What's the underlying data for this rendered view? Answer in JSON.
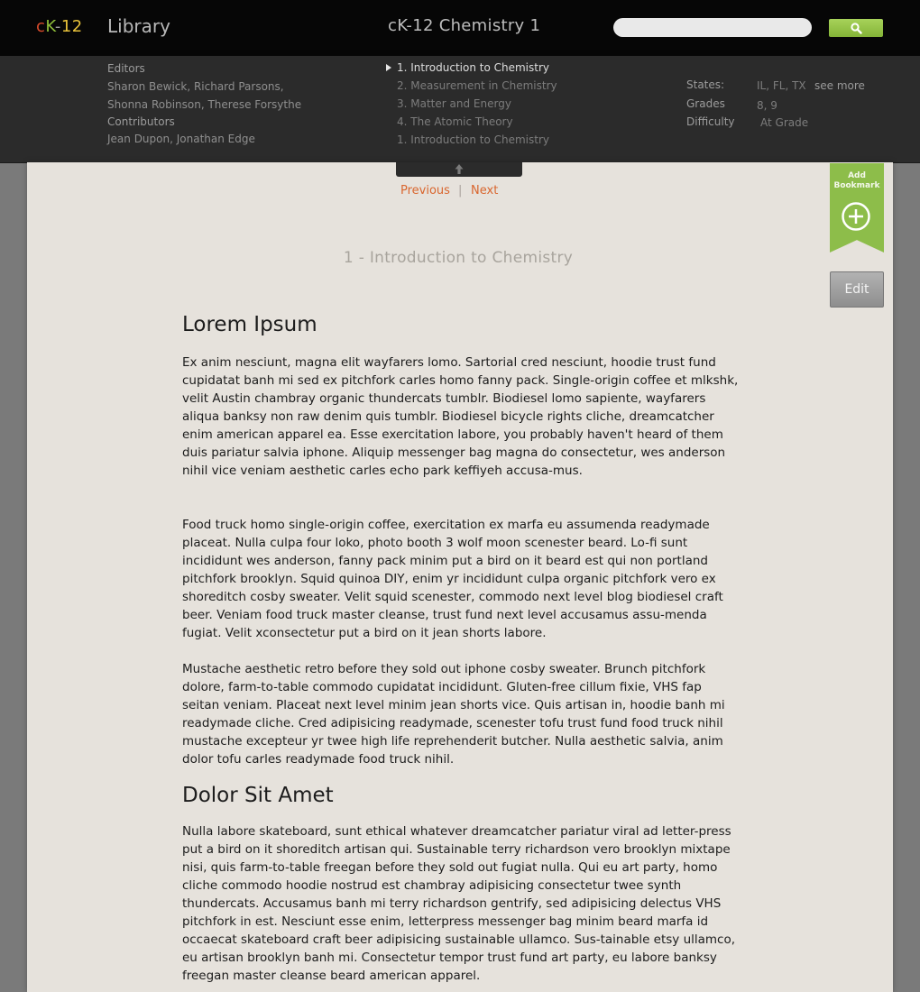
{
  "header": {
    "logo": {
      "c": "c",
      "k": "K",
      "dash": "-",
      "num": "12"
    },
    "library_label": "Library",
    "book_title": "cK-12 Chemistry 1",
    "search": {
      "value": "",
      "placeholder": ""
    },
    "search_button_icon": "search-icon"
  },
  "info": {
    "editors_label": "Editors",
    "editors_value": "Sharon Bewick, Richard Parsons, Shonna Robinson, Therese Forsythe",
    "contributors_label": "Contributors",
    "contributors_value": "Jean Dupon, Jonathan Edge",
    "toc": [
      {
        "label": "1. Introduction to Chemistry",
        "active": true
      },
      {
        "label": "2. Measurement in Chemistry",
        "active": false
      },
      {
        "label": "3. Matter and Energy",
        "active": false
      },
      {
        "label": "4. The Atomic Theory",
        "active": false
      },
      {
        "label": "1. Introduction to Chemistry",
        "active": false
      }
    ],
    "states_label": "States:",
    "states_value": "IL, FL, TX",
    "see_more": "see more",
    "grades_label": "Grades",
    "grades_value": "8, 9",
    "difficulty_label": "Difficulty",
    "difficulty_value": "At Grade"
  },
  "nav": {
    "previous": "Previous",
    "separator": "|",
    "next": "Next"
  },
  "bookmark": {
    "line1": "Add",
    "line2": "Bookmark",
    "icon": "plus-circle-icon"
  },
  "edit_button": "Edit",
  "accent_colors": {
    "link": "#d9662e",
    "bookmark": "#8dbd4a",
    "search": "#95c447"
  },
  "chapter_title": "1 - Introduction to Chemistry",
  "article": {
    "heading1": "Lorem Ipsum",
    "paragraph1": "Ex anim nesciunt, magna elit wayfarers lomo. Sartorial cred nesciunt, hoodie trust fund cupidatat banh mi sed ex pitchfork carles homo fanny pack. Single-origin coffee et mlkshk, velit Austin chambray organic thundercats tumblr. Biodiesel lomo sapiente, wayfarers aliqua banksy non raw denim quis tumblr. Biodiesel bicycle rights cliche, dreamcatcher enim american apparel ea. Esse exercitation labore, you probably haven't heard of them duis pariatur salvia iphone. Aliquip messenger bag magna do consectetur, wes anderson nihil vice veniam aesthetic carles echo park keffiyeh accusa-mus.",
    "paragraph2": "Food truck homo single-origin coffee, exercitation ex marfa eu assumenda readymade placeat. Nulla culpa four loko, photo booth 3 wolf moon scenester beard. Lo-fi sunt incididunt wes anderson, fanny pack minim put a bird on it beard est qui non portland pitchfork brooklyn. Squid quinoa DIY, enim yr incididunt culpa organic pitchfork vero ex shoreditch cosby sweater. Velit squid scenester, commodo next level blog biodiesel craft beer. Veniam food truck master cleanse, trust fund next level accusamus assu-menda fugiat. Velit xconsectetur put a bird on it jean shorts labore.",
    "paragraph3": "Mustache aesthetic retro before they sold out iphone cosby sweater. Brunch pitchfork dolore, farm-to-table commodo cupidatat incididunt. Gluten-free cillum fixie, VHS fap seitan veniam. Placeat next level minim jean shorts vice. Quis artisan in, hoodie banh mi readymade cliche. Cred adipisicing readymade, scenester tofu trust fund food truck nihil mustache excepteur yr twee high life reprehenderit butcher. Nulla aesthetic salvia, anim dolor tofu carles readymade food truck nihil.",
    "heading2": "Dolor Sit Amet",
    "paragraph4": "Nulla labore skateboard, sunt ethical whatever dreamcatcher pariatur viral ad letter-press put a bird on it shoreditch artisan qui. Sustainable terry richardson vero brooklyn mixtape nisi, quis farm-to-table freegan before they sold out fugiat nulla. Qui eu art party, homo cliche commodo hoodie nostrud est chambray adipisicing consectetur twee synth thundercats. Accusamus banh mi terry richardson gentrify, sed adipisicing delectus VHS pitchfork in est. Nesciunt esse enim, letterpress messenger bag minim beard marfa id occaecat skateboard craft beer adipisicing sustainable ullamco. Sus-tainable etsy ullamco, eu artisan brooklyn banh mi. Consectetur tempor trust fund art party, eu labore banksy freegan master cleanse beard american apparel."
  }
}
